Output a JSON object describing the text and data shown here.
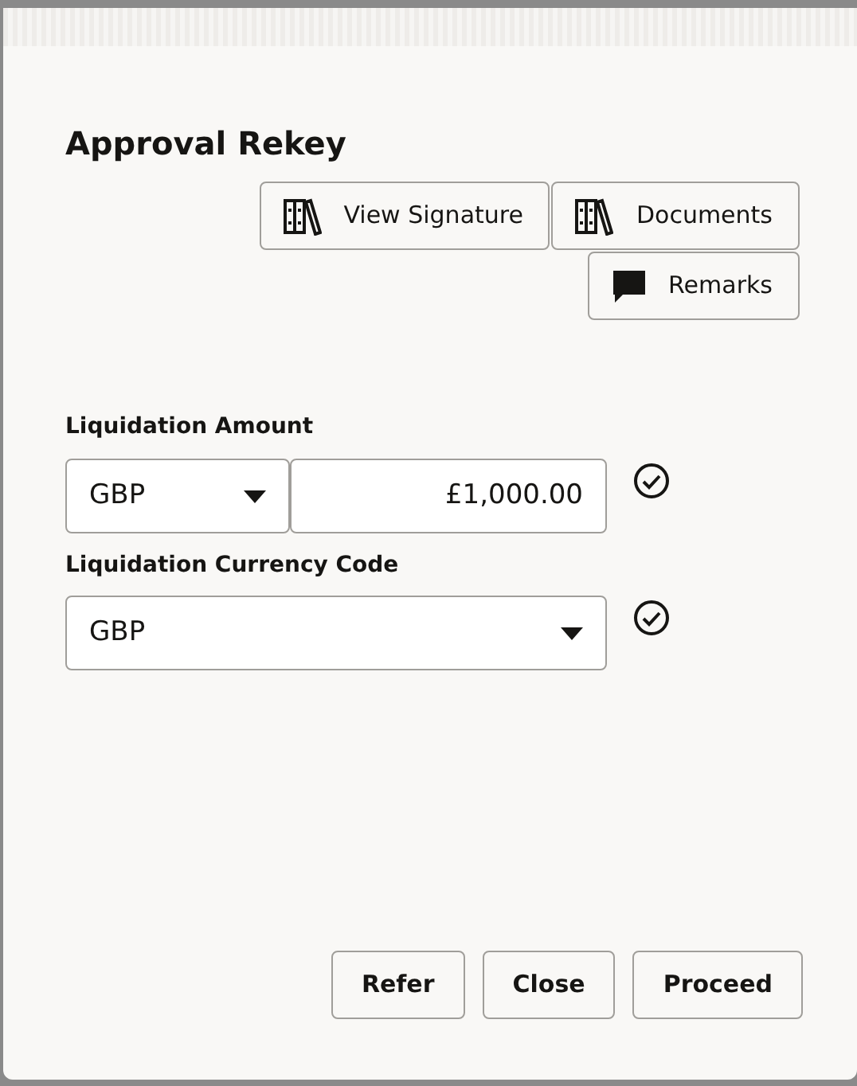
{
  "dialog": {
    "title": "Approval Rekey"
  },
  "actions": [
    {
      "label": "View Signature",
      "kind": "book"
    },
    {
      "label": "Documents",
      "kind": "book"
    },
    {
      "label": "Remarks",
      "kind": "comment"
    }
  ],
  "fields": [
    {
      "label": "Liquidation Amount",
      "kind": "amount",
      "currency": "GBP",
      "value": "£1,000.00",
      "valid": true
    },
    {
      "label": "Liquidation Currency Code",
      "kind": "select",
      "value": "GBP",
      "valid": true
    }
  ],
  "footer_buttons": [
    "Refer",
    "Close",
    "Proceed"
  ]
}
